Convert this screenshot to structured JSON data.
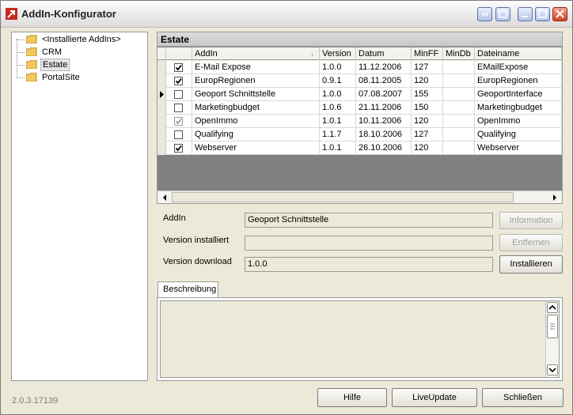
{
  "window": {
    "title": "AddIn-Konfigurator"
  },
  "tree": {
    "items": [
      {
        "label": "<Installierte AddIns>",
        "selected": false
      },
      {
        "label": "CRM",
        "selected": false
      },
      {
        "label": "Estate",
        "selected": true
      },
      {
        "label": "PortalSite",
        "selected": false
      }
    ]
  },
  "grid": {
    "caption": "Estate",
    "columns": [
      "AddIn",
      "Version",
      "Datum",
      "MinFF",
      "MinDb",
      "Dateiname"
    ],
    "sort_indicator": "↓",
    "current_row": 2,
    "rows": [
      {
        "checked": true,
        "enabled": true,
        "addin": "E-Mail Expose",
        "version": "1.0.0",
        "datum": "11.12.2006",
        "minff": "127",
        "mindb": "",
        "dateiname": "EMailExpose"
      },
      {
        "checked": true,
        "enabled": true,
        "addin": "EuropRegionen",
        "version": "0.9.1",
        "datum": "08.11.2005",
        "minff": "120",
        "mindb": "",
        "dateiname": "EuropRegionen"
      },
      {
        "checked": false,
        "enabled": true,
        "addin": "Geoport Schnittstelle",
        "version": "1.0.0",
        "datum": "07.08.2007",
        "minff": "155",
        "mindb": "",
        "dateiname": "GeoportInterface"
      },
      {
        "checked": false,
        "enabled": true,
        "addin": "Marketingbudget",
        "version": "1.0.6",
        "datum": "21.11.2006",
        "minff": "150",
        "mindb": "",
        "dateiname": "Marketingbudget"
      },
      {
        "checked": true,
        "enabled": false,
        "addin": "OpenImmo",
        "version": "1.0.1",
        "datum": "10.11.2006",
        "minff": "120",
        "mindb": "",
        "dateiname": "OpenImmo"
      },
      {
        "checked": false,
        "enabled": true,
        "addin": "Qualifying",
        "version": "1.1.7",
        "datum": "18.10.2006",
        "minff": "127",
        "mindb": "",
        "dateiname": "Qualifying"
      },
      {
        "checked": true,
        "enabled": true,
        "addin": "Webserver",
        "version": "1.0.1",
        "datum": "26.10.2006",
        "minff": "120",
        "mindb": "",
        "dateiname": "Webserver"
      }
    ]
  },
  "details": {
    "addin_label": "AddIn",
    "addin_value": "Geoport Schnittstelle",
    "version_installed_label": "Version installiert",
    "version_installed_value": "",
    "version_download_label": "Version download",
    "version_download_value": "1.0.0",
    "info_button": "Information",
    "remove_button": "Entfernen",
    "install_button": "Installieren"
  },
  "description": {
    "tab_label": "Beschreibung",
    "text": ""
  },
  "footer": {
    "version": "2.0.3.17139",
    "help_button": "Hilfe",
    "liveupdate_button": "LiveUpdate",
    "close_button": "Schließen"
  },
  "colors": {
    "grid_background": "#808080",
    "window_background": "#ece9d8",
    "close_red": "#d0442a"
  }
}
